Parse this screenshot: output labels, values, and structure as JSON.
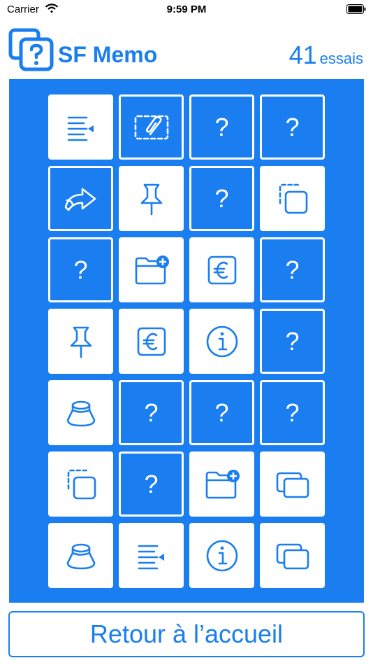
{
  "status": {
    "carrier": "Carrier",
    "time": "9:59 PM"
  },
  "header": {
    "title": "SF Memo",
    "attempts_count": "41",
    "attempts_label": "essais"
  },
  "colors": {
    "accent": "#1a7ef0",
    "card_front": "#ffffff"
  },
  "cards": [
    {
      "state": "shown",
      "icon": "text-insert-icon"
    },
    {
      "state": "flip",
      "icon": "paperclip-selection-icon"
    },
    {
      "state": "hidden",
      "label": "?"
    },
    {
      "state": "hidden",
      "label": "?"
    },
    {
      "state": "flip",
      "icon": "share-arrow-icon"
    },
    {
      "state": "shown",
      "icon": "pin-icon"
    },
    {
      "state": "hidden",
      "label": "?"
    },
    {
      "state": "shown",
      "icon": "duplicate-square-icon"
    },
    {
      "state": "hidden",
      "label": "?"
    },
    {
      "state": "shown",
      "icon": "folder-add-icon"
    },
    {
      "state": "shown",
      "icon": "euro-sign-icon"
    },
    {
      "state": "hidden",
      "label": "?"
    },
    {
      "state": "shown",
      "icon": "pin-icon"
    },
    {
      "state": "shown",
      "icon": "euro-sign-icon"
    },
    {
      "state": "shown",
      "icon": "info-circle-icon"
    },
    {
      "state": "hidden",
      "label": "?"
    },
    {
      "state": "shown",
      "icon": "cup-cone-icon"
    },
    {
      "state": "hidden",
      "label": "?"
    },
    {
      "state": "hidden",
      "label": "?"
    },
    {
      "state": "hidden",
      "label": "?"
    },
    {
      "state": "shown",
      "icon": "duplicate-square-icon"
    },
    {
      "state": "hidden",
      "label": "?"
    },
    {
      "state": "shown",
      "icon": "folder-add-icon"
    },
    {
      "state": "shown",
      "icon": "windows-stack-icon"
    },
    {
      "state": "shown",
      "icon": "cup-cone-icon"
    },
    {
      "state": "shown",
      "icon": "text-insert-icon"
    },
    {
      "state": "shown",
      "icon": "info-circle-icon"
    },
    {
      "state": "shown",
      "icon": "windows-stack-icon"
    }
  ],
  "footer": {
    "home_label": "Retour à l’accueil"
  }
}
